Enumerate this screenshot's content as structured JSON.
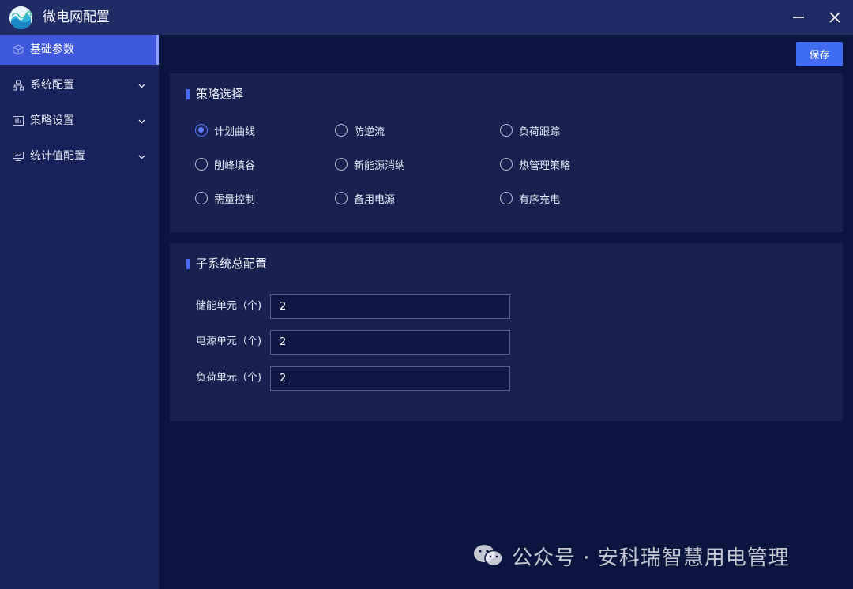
{
  "window": {
    "title": "微电网配置",
    "minimize_icon": "minimize-icon",
    "close_icon": "close-icon"
  },
  "sidebar": {
    "items": [
      {
        "label": "基础参数",
        "icon": "cube-icon",
        "active": true
      },
      {
        "label": "系统配置",
        "icon": "hierarchy-icon",
        "expandable": true
      },
      {
        "label": "策略设置",
        "icon": "chart-icon",
        "expandable": true
      },
      {
        "label": "统计值配置",
        "icon": "monitor-icon",
        "expandable": true
      }
    ]
  },
  "toolbar": {
    "save_label": "保存"
  },
  "strategy": {
    "title": "策略选择",
    "options": [
      {
        "label": "计划曲线",
        "checked": true
      },
      {
        "label": "防逆流",
        "checked": false
      },
      {
        "label": "负荷跟踪",
        "checked": false
      },
      {
        "label": "削峰填谷",
        "checked": false
      },
      {
        "label": "新能源消纳",
        "checked": false
      },
      {
        "label": "热管理策略",
        "checked": false
      },
      {
        "label": "需量控制",
        "checked": false
      },
      {
        "label": "备用电源",
        "checked": false
      },
      {
        "label": "有序充电",
        "checked": false
      }
    ]
  },
  "subsystem": {
    "title": "子系统总配置",
    "fields": [
      {
        "label": "储能单元（个)",
        "value": "2"
      },
      {
        "label": "电源单元（个)",
        "value": "2"
      },
      {
        "label": "负荷单元（个)",
        "value": "2"
      }
    ]
  },
  "watermark": {
    "text": "公众号 · 安科瑞智慧用电管理",
    "icon": "wechat-icon"
  },
  "colors": {
    "background": "#0b1640",
    "titlebar": "#1f2b64",
    "sidebar": "#17225a",
    "card": "#172253",
    "accent": "#3f6cf2",
    "active_nav": "#4058dd"
  }
}
